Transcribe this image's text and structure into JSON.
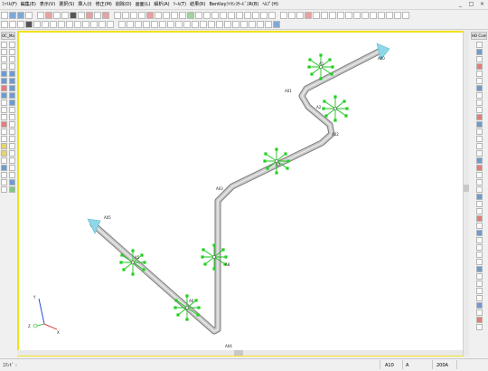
{
  "menubar": {
    "items": [
      "ﾌｧｲﾙ(F)",
      "編集(E)",
      "表示(V)",
      "選択(S)",
      "挿入(I)",
      "修正(M)",
      "削除(D)",
      "画面(L)",
      "解析(A)",
      "ﾂｰﾙ(T)",
      "結果(R)",
      "BentleyﾗｲｾﾝｽｻｰﾋﾞｽR(B)",
      "ﾍﾙﾌﾟ(H)"
    ],
    "window_buttons": [
      "_",
      "□",
      "×"
    ]
  },
  "left_panel": {
    "tab_label": "OC_Main"
  },
  "right_panel": {
    "tab_label": "HO Compo"
  },
  "model": {
    "node_labels": [
      "A00",
      "A01",
      "A02",
      "A03",
      "A04",
      "A05"
    ],
    "element_labels": [
      "A2",
      "A1",
      "A8",
      "A7",
      "A6",
      "A5"
    ],
    "axis_labels": {
      "x": "X",
      "y": "Y",
      "z": "Z"
    }
  },
  "statusbar": {
    "prompt": "ｺﾏﾝﾄﾞ :",
    "node": "A10",
    "code": "A",
    "size": "200A"
  }
}
